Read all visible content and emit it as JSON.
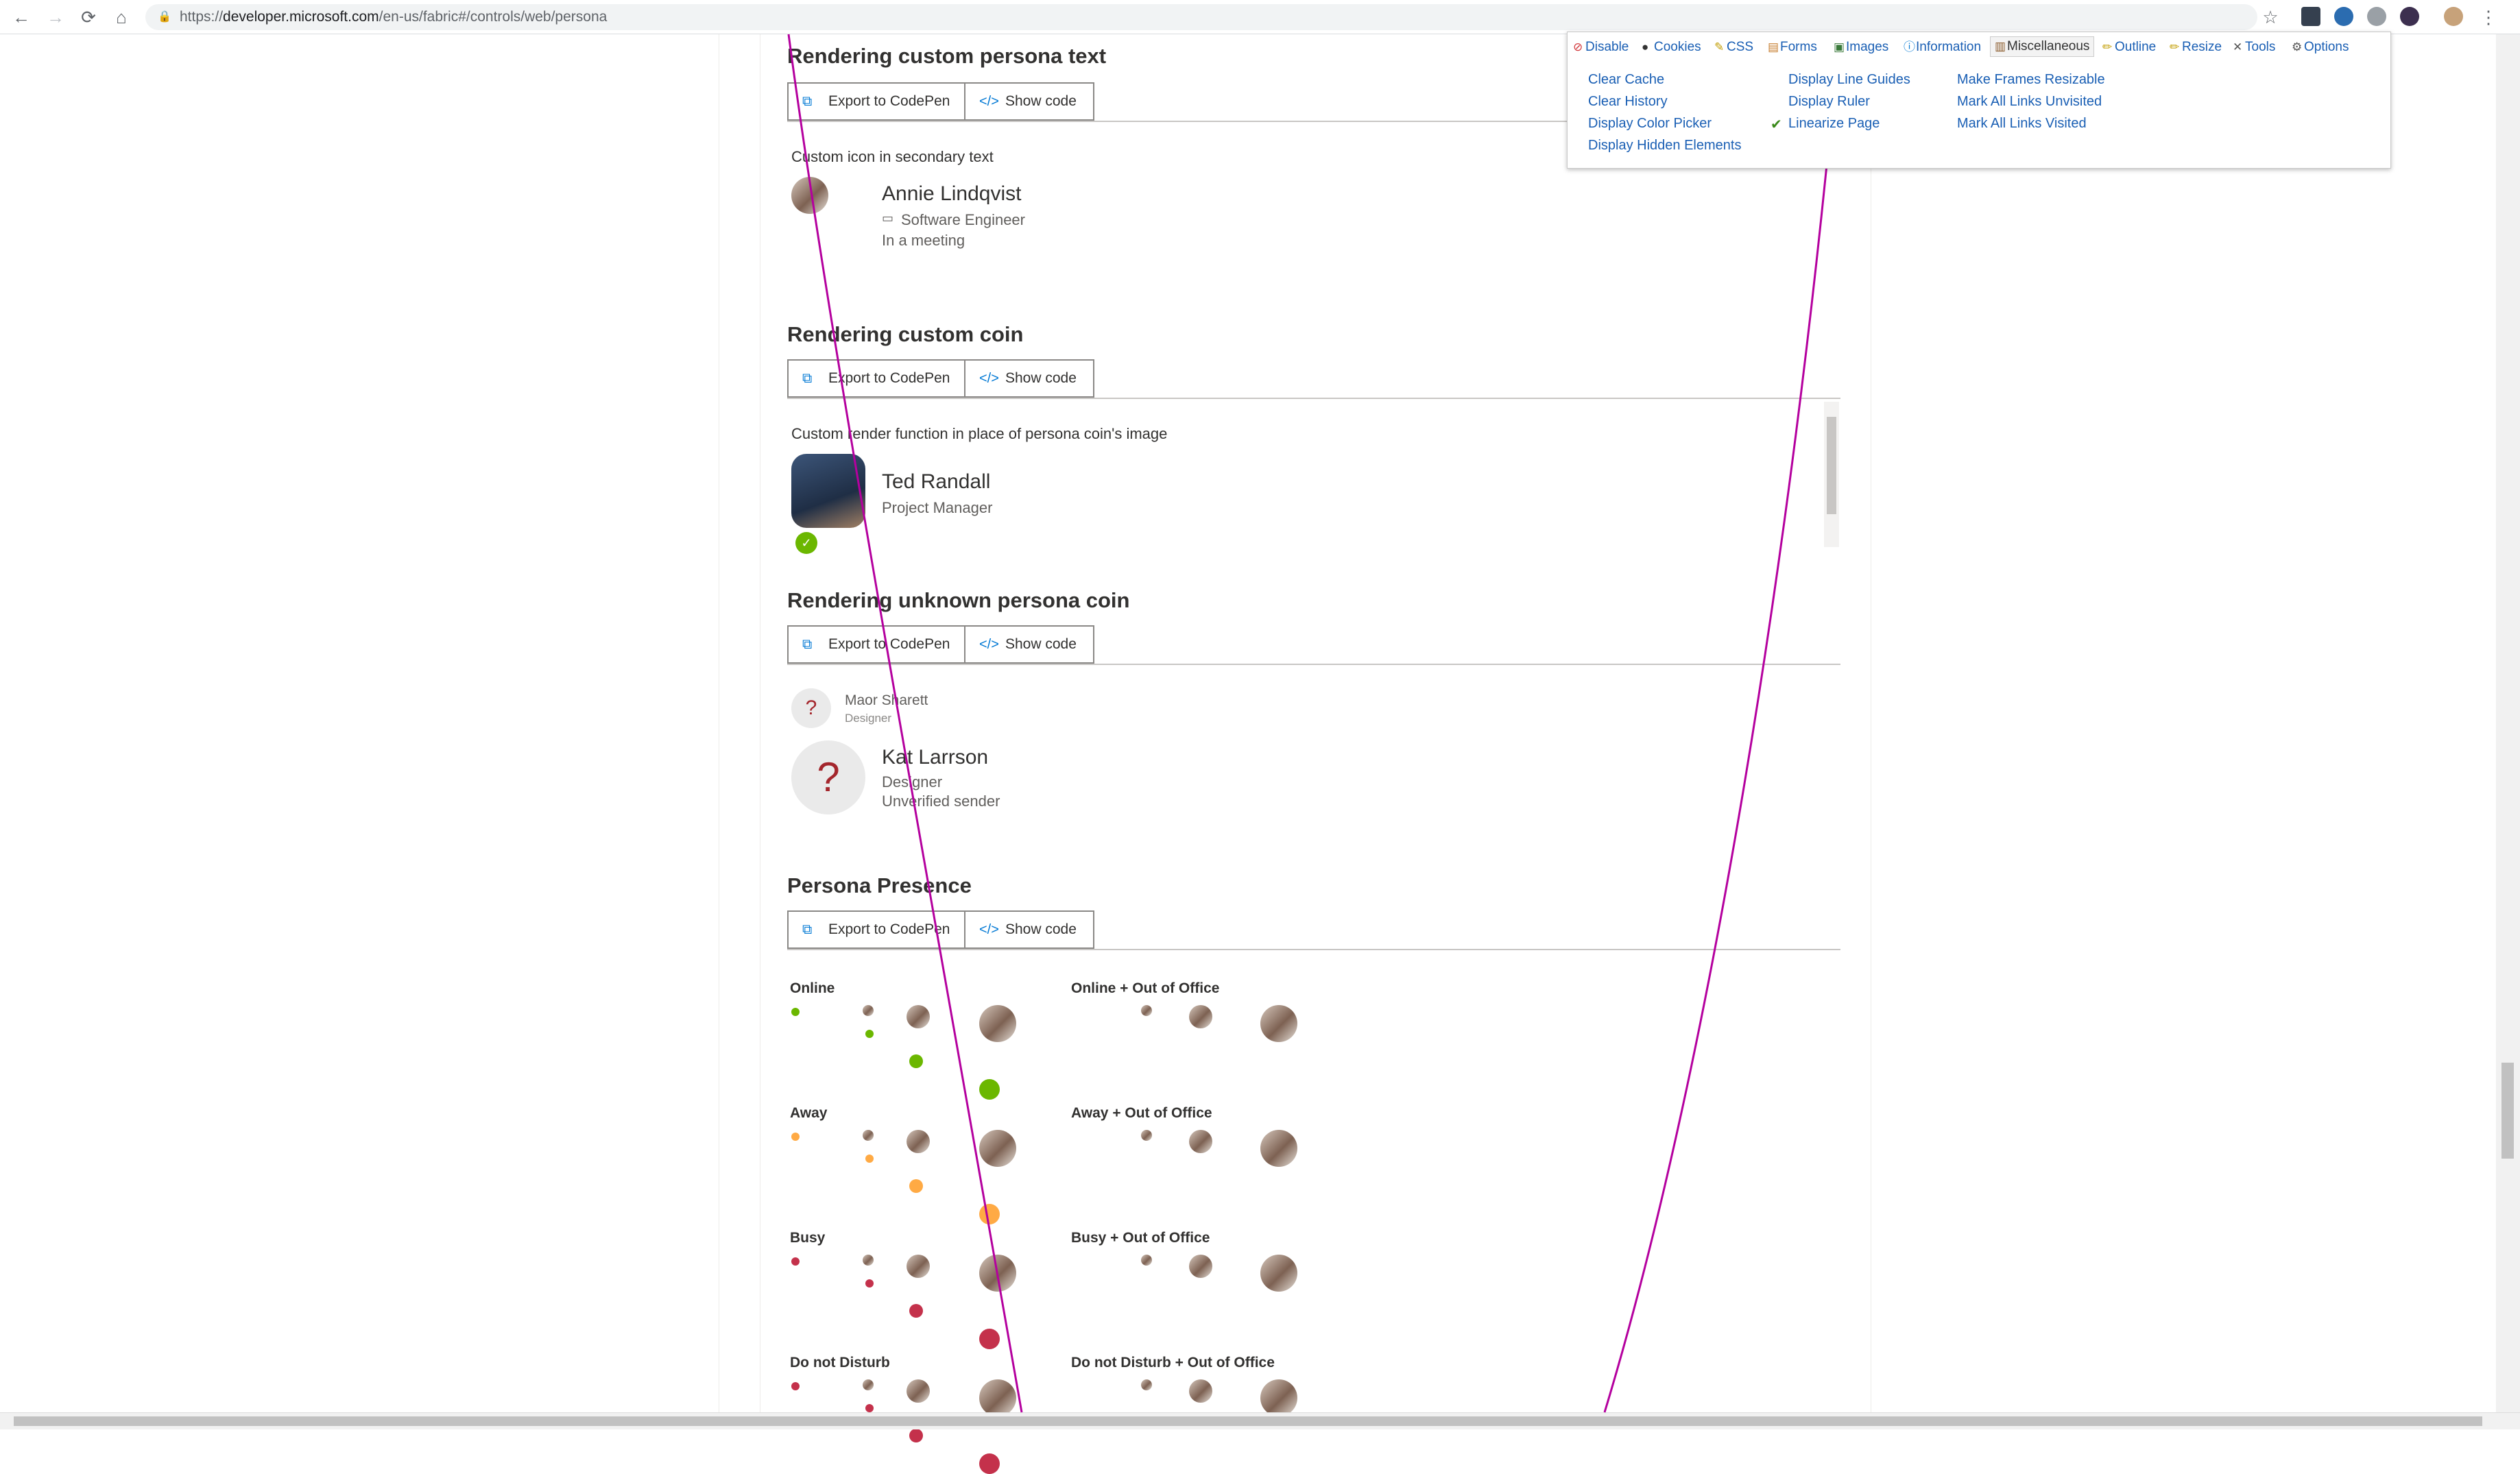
{
  "browser": {
    "url_prefix": "https://",
    "url_host": "developer.microsoft.com",
    "url_path": "/en-us/fabric#/controls/web/persona",
    "back_icon": "←",
    "forward_icon": "→",
    "reload_icon": "⟳",
    "home_icon": "⌂",
    "star_icon": "☆",
    "menu_icon": "⋮"
  },
  "web_developer": {
    "tabs": [
      "Disable",
      "Cookies",
      "CSS",
      "Forms",
      "Images",
      "Information",
      "Miscellaneous",
      "Outline",
      "Resize",
      "Tools",
      "Options"
    ],
    "col1": [
      "Clear Cache",
      "Clear History",
      "Display Color Picker",
      "Display Hidden Elements"
    ],
    "col2": [
      "Display Line Guides",
      "Display Ruler",
      "Linearize Page"
    ],
    "col3": [
      "Make Frames Resizable",
      "Mark All Links Unvisited",
      "Mark All Links Visited"
    ],
    "check_icon": "✔"
  },
  "buttons": {
    "export": "Export to CodePen",
    "show_code": "Show code"
  },
  "sections": {
    "custom_text": {
      "title": "Rendering custom persona text",
      "description": "Custom icon in secondary text",
      "name": "Annie Lindqvist",
      "role": "Software Engineer",
      "status": "In a meeting"
    },
    "custom_coin": {
      "title": "Rendering custom coin",
      "description": "Custom render function in place of persona coin's image",
      "name": "Ted Randall",
      "role": "Project Manager"
    },
    "unknown_coin": {
      "title": "Rendering unknown persona coin",
      "small_name": "Maor Sharett",
      "small_role": "Designer",
      "name": "Kat Larrson",
      "role": "Designer",
      "status": "Unverified sender",
      "unknown_glyph": "?"
    },
    "presence": {
      "title": "Persona Presence",
      "left_labels": [
        "Online",
        "Away",
        "Busy",
        "Do not Disturb"
      ],
      "right_labels": [
        "Online + Out of Office",
        "Away + Out of Office",
        "Busy + Out of Office",
        "Do not Disturb + Out of Office"
      ]
    }
  },
  "colors": {
    "online": "#6bb700",
    "away": "#ffaa44",
    "busy": "#c4314b",
    "guide": "#b4009e",
    "link": "#0078d4"
  }
}
